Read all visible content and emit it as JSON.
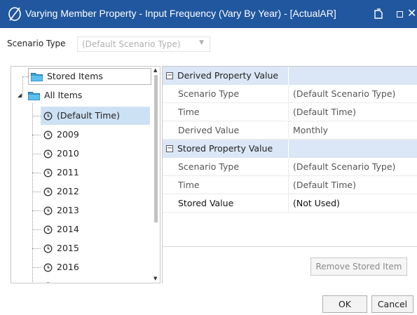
{
  "window": {
    "title": "Varying Member Property - Input Frequency (Vary By Year) - [ActualAR]",
    "brand_color": "#20579f"
  },
  "scenario": {
    "label": "Scenario Type",
    "value": "(Default Scenario Type)"
  },
  "tree": {
    "root_stored": "Stored Items",
    "root_all": "All Items",
    "items": [
      "(Default Time)",
      "2009",
      "2010",
      "2011",
      "2012",
      "2013",
      "2014",
      "2015",
      "2016"
    ],
    "selected": "(Default Time)"
  },
  "grid": {
    "derived": {
      "header": "Derived Property Value",
      "rows": [
        {
          "name": "Scenario Type",
          "value": "(Default Scenario Type)"
        },
        {
          "name": "Time",
          "value": "(Default Time)"
        },
        {
          "name": "Derived Value",
          "value": "Monthly"
        }
      ]
    },
    "stored": {
      "header": "Stored Property Value",
      "rows": [
        {
          "name": "Scenario Type",
          "value": "(Default Scenario Type)"
        },
        {
          "name": "Time",
          "value": "(Default Time)"
        },
        {
          "name": "Stored Value",
          "value": "(Not Used)"
        }
      ]
    },
    "remove_label": "Remove Stored Item"
  },
  "buttons": {
    "ok": "OK",
    "cancel": "Cancel"
  }
}
